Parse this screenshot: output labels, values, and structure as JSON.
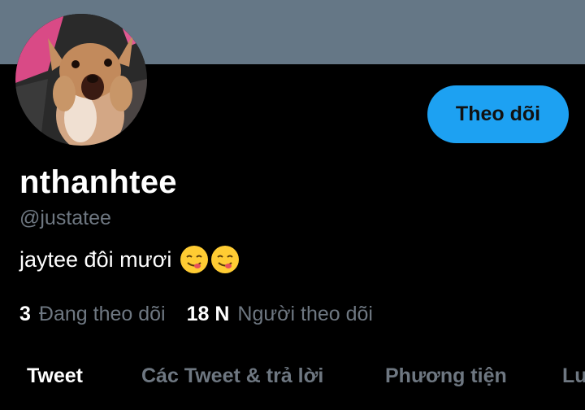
{
  "profile": {
    "display_name": "nthanhtee",
    "handle": "@justatee",
    "bio_text": "jaytee đôi mươi",
    "bio_emojis": [
      "smiling-face-savoring-food-icon",
      "smiling-face-savoring-food-icon"
    ],
    "follow_button": "Theo dõi",
    "avatar": "dog-photo"
  },
  "stats": {
    "following_count": "3",
    "following_label": "Đang theo dõi",
    "followers_count": "18 N",
    "followers_label": "Người theo dõi"
  },
  "tabs": [
    {
      "label": "Tweet",
      "active": true
    },
    {
      "label": "Các Tweet & trả lời",
      "active": false
    },
    {
      "label": "Phương tiện",
      "active": false
    },
    {
      "label": "Lượt thích",
      "active": false
    }
  ],
  "colors": {
    "accent": "#1da1f2",
    "banner": "#657786",
    "background": "#000000",
    "muted_text": "#6e7781"
  }
}
